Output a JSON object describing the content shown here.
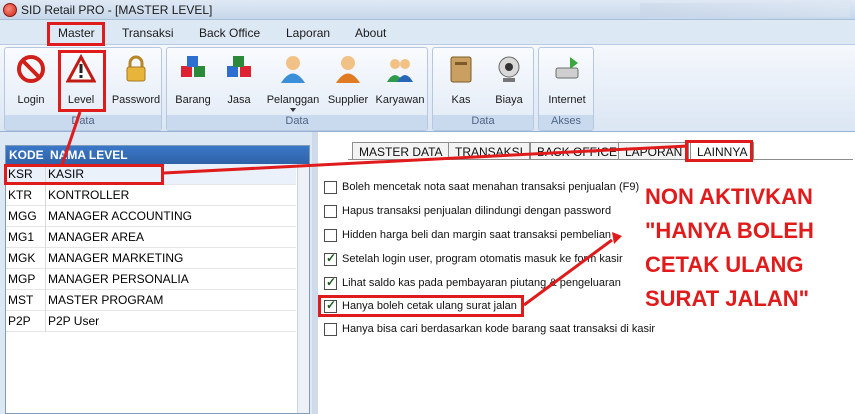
{
  "window": {
    "title": "SID Retail PRO - [MASTER LEVEL]"
  },
  "menu": [
    "Master",
    "Transaksi",
    "Back Office",
    "Laporan",
    "About"
  ],
  "ribbon": {
    "groups": [
      {
        "label": "Data",
        "buttons": [
          "Login",
          "Level",
          "Password"
        ]
      },
      {
        "label": "Data",
        "buttons": [
          "Barang",
          "Jasa",
          "Pelanggan",
          "Supplier",
          "Karyawan"
        ]
      },
      {
        "label": "Data",
        "buttons": [
          "Kas",
          "Biaya"
        ]
      },
      {
        "label": "Akses",
        "buttons": [
          "Internet"
        ]
      }
    ]
  },
  "grid": {
    "headers": [
      "KODE",
      "NAMA LEVEL"
    ],
    "rows": [
      {
        "kode": "KSR",
        "nama": "KASIR"
      },
      {
        "kode": "KTR",
        "nama": "KONTROLLER"
      },
      {
        "kode": "MGG",
        "nama": "MANAGER ACCOUNTING"
      },
      {
        "kode": "MG1",
        "nama": "MANAGER AREA"
      },
      {
        "kode": "MGK",
        "nama": "MANAGER MARKETING"
      },
      {
        "kode": "MGP",
        "nama": "MANAGER PERSONALIA"
      },
      {
        "kode": "MST",
        "nama": "MASTER PROGRAM"
      },
      {
        "kode": "P2P",
        "nama": "P2P User"
      }
    ]
  },
  "tabs": [
    "MASTER DATA",
    "TRANSAKSI",
    "BACK OFFICE",
    "LAPORAN",
    "LAINNYA"
  ],
  "options": [
    {
      "label": "Boleh mencetak nota saat menahan transaksi penjualan (F9)",
      "checked": false
    },
    {
      "label": "Hapus transaksi penjualan dilindungi dengan password",
      "checked": false
    },
    {
      "label": "Hidden harga beli dan margin saat transaksi pembelian",
      "checked": false
    },
    {
      "label": "Setelah login user, program otomatis masuk ke form kasir",
      "checked": true
    },
    {
      "label": "Lihat saldo kas pada pembayaran piutang & pengeluaran",
      "checked": true
    },
    {
      "label": "Hanya boleh cetak ulang surat jalan",
      "checked": true
    },
    {
      "label": "Hanya bisa cari berdasarkan kode barang saat transaksi di kasir",
      "checked": false
    }
  ],
  "annotation": {
    "lines": [
      "NON AKTIVKAN",
      "\"HANYA BOLEH",
      "CETAK ULANG",
      "SURAT JALAN\""
    ]
  },
  "colors": {
    "highlight": "#e01b1b",
    "grid_header": "#2f62a8"
  }
}
